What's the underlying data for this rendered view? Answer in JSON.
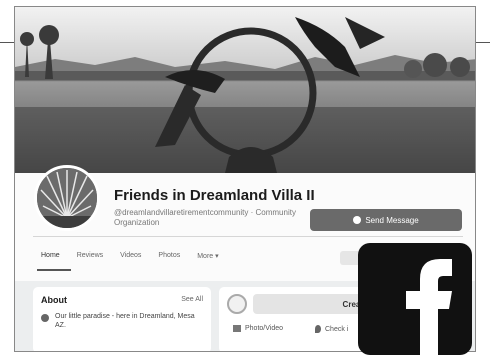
{
  "page": {
    "name": "Friends in Dreamland Villa II",
    "handle_category": "@dreamlandvillaretirementcommunity · Community Organization",
    "send_message_label": "Send Message"
  },
  "tabs": [
    {
      "label": "Home",
      "active": true
    },
    {
      "label": "Reviews",
      "active": false
    },
    {
      "label": "Videos",
      "active": false
    },
    {
      "label": "Photos",
      "active": false
    },
    {
      "label": "More ▾",
      "active": false
    }
  ],
  "about": {
    "title": "About",
    "see_all_label": "See All",
    "description": "Our little paradise - here in Dreamland, Mesa AZ."
  },
  "composer": {
    "create_label": "Create",
    "photo_video_label": "Photo/Video",
    "check_in_label": "Check i"
  },
  "icons": {
    "message": "messenger-icon",
    "info": "info-icon",
    "photo": "photo-icon",
    "location": "location-pin-icon",
    "brand": "facebook-logo-icon"
  },
  "colors": {
    "brand_tile": "#111111",
    "button": "#6a6a6a",
    "page_bg": "#eceeef"
  }
}
